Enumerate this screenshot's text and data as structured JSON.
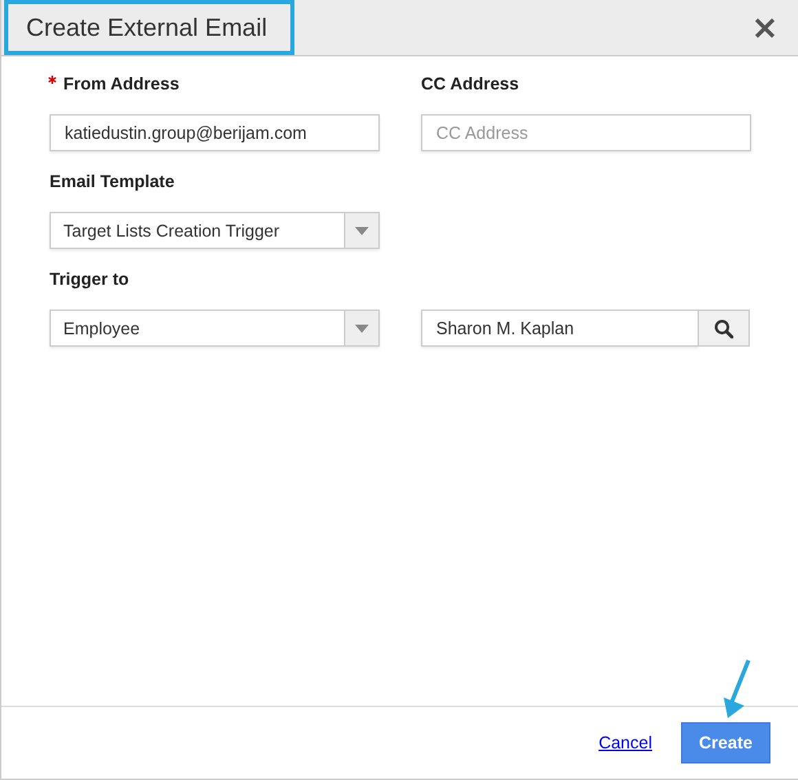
{
  "dialog": {
    "title": "Create External Email",
    "title_highlighted": true,
    "close": "×"
  },
  "rows": [
    {
      "fields": [
        {
          "kind": "text",
          "label": "From Address",
          "required": true,
          "value": "katiedustin.group@berijam.com"
        },
        {
          "kind": "text",
          "label": "CC Address",
          "required": false,
          "placeholder": "CC Address"
        }
      ]
    },
    {
      "fields": [
        {
          "kind": "select",
          "label": "Email Template",
          "required": false,
          "value": "Target Lists Creation Trigger"
        }
      ]
    },
    {
      "fields": [
        {
          "kind": "select",
          "label": "Trigger to",
          "required": false,
          "value": "Employee"
        },
        {
          "kind": "search",
          "value": "Sharon M. Kaplan"
        }
      ]
    }
  ],
  "footer": {
    "cancel": "Cancel",
    "create": "Create",
    "create_pointed": true
  }
}
